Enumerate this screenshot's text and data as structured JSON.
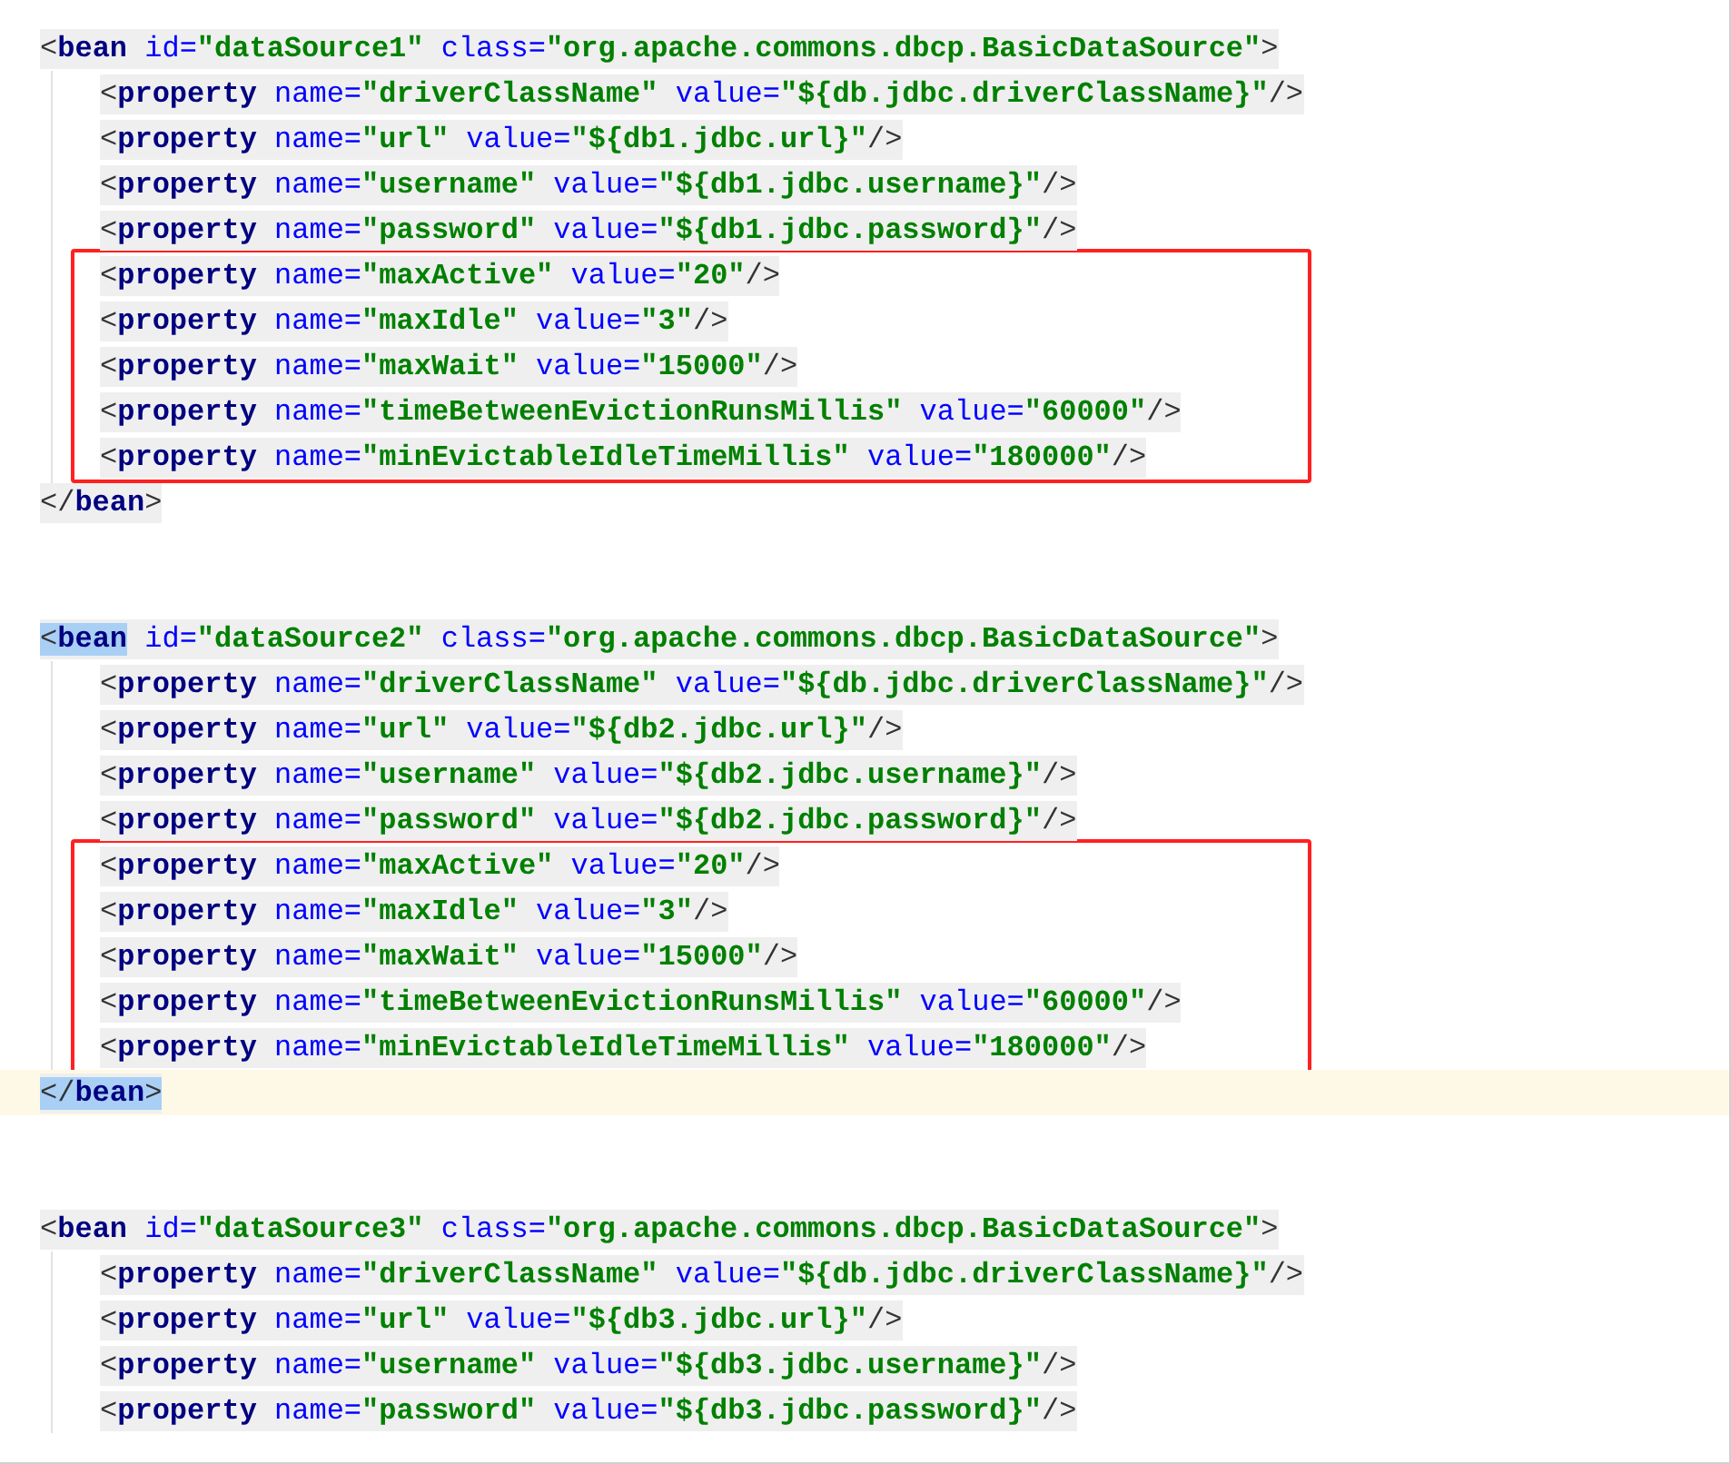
{
  "editor": {
    "beans": [
      {
        "open": {
          "open": "<",
          "tag": "bean",
          "attrs": [
            {
              "name": "id=",
              "value": "\"dataSource1\""
            },
            {
              "name": "class=",
              "value": "\"org.apache.commons.dbcp.BasicDataSource\""
            }
          ],
          "end": ">",
          "matched": false,
          "current": false
        },
        "rows": [
          {
            "kind": "line",
            "open": "<",
            "tag": "property",
            "attrs": [
              {
                "name": "name=",
                "value": "\"driverClassName\""
              },
              {
                "name": "value=",
                "value": "\"${db.jdbc.driverClassName}\""
              }
            ],
            "end": "/>"
          },
          {
            "kind": "line",
            "open": "<",
            "tag": "property",
            "attrs": [
              {
                "name": "name=",
                "value": "\"url\""
              },
              {
                "name": "value=",
                "value": "\"${db1.jdbc.url}\""
              }
            ],
            "end": "/>"
          },
          {
            "kind": "line",
            "open": "<",
            "tag": "property",
            "attrs": [
              {
                "name": "name=",
                "value": "\"username\""
              },
              {
                "name": "value=",
                "value": "\"${db1.jdbc.username}\""
              }
            ],
            "end": "/>"
          },
          {
            "kind": "line",
            "open": "<",
            "tag": "property",
            "attrs": [
              {
                "name": "name=",
                "value": "\"password\""
              },
              {
                "name": "value=",
                "value": "\"${db1.jdbc.password}\""
              }
            ],
            "end": "/>"
          },
          {
            "kind": "boxed",
            "lines": [
              {
                "open": "<",
                "tag": "property",
                "attrs": [
                  {
                    "name": "name=",
                    "value": "\"maxActive\""
                  },
                  {
                    "name": "value=",
                    "value": "\"20\""
                  }
                ],
                "end": "/>"
              },
              {
                "open": "<",
                "tag": "property",
                "attrs": [
                  {
                    "name": "name=",
                    "value": "\"maxIdle\""
                  },
                  {
                    "name": "value=",
                    "value": "\"3\""
                  }
                ],
                "end": "/>"
              },
              {
                "open": "<",
                "tag": "property",
                "attrs": [
                  {
                    "name": "name=",
                    "value": "\"maxWait\""
                  },
                  {
                    "name": "value=",
                    "value": "\"15000\""
                  }
                ],
                "end": "/>"
              },
              {
                "open": "<",
                "tag": "property",
                "attrs": [
                  {
                    "name": "name=",
                    "value": "\"timeBetweenEvictionRunsMillis\""
                  },
                  {
                    "name": "value=",
                    "value": "\"60000\""
                  }
                ],
                "end": "/>"
              },
              {
                "open": "<",
                "tag": "property",
                "attrs": [
                  {
                    "name": "name=",
                    "value": "\"minEvictableIdleTimeMillis\""
                  },
                  {
                    "name": "value=",
                    "value": "\"180000\""
                  }
                ],
                "end": "/>"
              }
            ]
          }
        ],
        "close": {
          "open": "</",
          "tag": "bean",
          "end": ">",
          "matched": false,
          "current": false
        }
      },
      {
        "open": {
          "open": "<",
          "tag": "bean",
          "attrs": [
            {
              "name": "id=",
              "value": "\"dataSource2\""
            },
            {
              "name": "class=",
              "value": "\"org.apache.commons.dbcp.BasicDataSource\""
            }
          ],
          "end": ">",
          "matched": true,
          "current": false
        },
        "rows": [
          {
            "kind": "line",
            "open": "<",
            "tag": "property",
            "attrs": [
              {
                "name": "name=",
                "value": "\"driverClassName\""
              },
              {
                "name": "value=",
                "value": "\"${db.jdbc.driverClassName}\""
              }
            ],
            "end": "/>"
          },
          {
            "kind": "line",
            "open": "<",
            "tag": "property",
            "attrs": [
              {
                "name": "name=",
                "value": "\"url\""
              },
              {
                "name": "value=",
                "value": "\"${db2.jdbc.url}\""
              }
            ],
            "end": "/>"
          },
          {
            "kind": "line",
            "open": "<",
            "tag": "property",
            "attrs": [
              {
                "name": "name=",
                "value": "\"username\""
              },
              {
                "name": "value=",
                "value": "\"${db2.jdbc.username}\""
              }
            ],
            "end": "/>"
          },
          {
            "kind": "line",
            "open": "<",
            "tag": "property",
            "attrs": [
              {
                "name": "name=",
                "value": "\"password\""
              },
              {
                "name": "value=",
                "value": "\"${db2.jdbc.password}\""
              }
            ],
            "end": "/>"
          },
          {
            "kind": "boxed",
            "lines": [
              {
                "open": "<",
                "tag": "property",
                "attrs": [
                  {
                    "name": "name=",
                    "value": "\"maxActive\""
                  },
                  {
                    "name": "value=",
                    "value": "\"20\""
                  }
                ],
                "end": "/>"
              },
              {
                "open": "<",
                "tag": "property",
                "attrs": [
                  {
                    "name": "name=",
                    "value": "\"maxIdle\""
                  },
                  {
                    "name": "value=",
                    "value": "\"3\""
                  }
                ],
                "end": "/>"
              },
              {
                "open": "<",
                "tag": "property",
                "attrs": [
                  {
                    "name": "name=",
                    "value": "\"maxWait\""
                  },
                  {
                    "name": "value=",
                    "value": "\"15000\""
                  }
                ],
                "end": "/>"
              },
              {
                "open": "<",
                "tag": "property",
                "attrs": [
                  {
                    "name": "name=",
                    "value": "\"timeBetweenEvictionRunsMillis\""
                  },
                  {
                    "name": "value=",
                    "value": "\"60000\""
                  }
                ],
                "end": "/>"
              },
              {
                "open": "<",
                "tag": "property",
                "attrs": [
                  {
                    "name": "name=",
                    "value": "\"minEvictableIdleTimeMillis\""
                  },
                  {
                    "name": "value=",
                    "value": "\"180000\""
                  }
                ],
                "end": "/>"
              }
            ]
          }
        ],
        "close": {
          "open": "</",
          "tag": "bean",
          "end": ">",
          "matched": true,
          "current": true
        }
      },
      {
        "open": {
          "open": "<",
          "tag": "bean",
          "attrs": [
            {
              "name": "id=",
              "value": "\"dataSource3\""
            },
            {
              "name": "class=",
              "value": "\"org.apache.commons.dbcp.BasicDataSource\""
            }
          ],
          "end": ">",
          "matched": false,
          "current": false
        },
        "rows": [
          {
            "kind": "line",
            "open": "<",
            "tag": "property",
            "attrs": [
              {
                "name": "name=",
                "value": "\"driverClassName\""
              },
              {
                "name": "value=",
                "value": "\"${db.jdbc.driverClassName}\""
              }
            ],
            "end": "/>"
          },
          {
            "kind": "line",
            "open": "<",
            "tag": "property",
            "attrs": [
              {
                "name": "name=",
                "value": "\"url\""
              },
              {
                "name": "value=",
                "value": "\"${db3.jdbc.url}\""
              }
            ],
            "end": "/>"
          },
          {
            "kind": "line",
            "open": "<",
            "tag": "property",
            "attrs": [
              {
                "name": "name=",
                "value": "\"username\""
              },
              {
                "name": "value=",
                "value": "\"${db3.jdbc.username}\""
              }
            ],
            "end": "/>"
          },
          {
            "kind": "line",
            "open": "<",
            "tag": "property",
            "attrs": [
              {
                "name": "name=",
                "value": "\"password\""
              },
              {
                "name": "value=",
                "value": "\"${db3.jdbc.password}\""
              }
            ],
            "end": "/>"
          }
        ]
      }
    ]
  }
}
